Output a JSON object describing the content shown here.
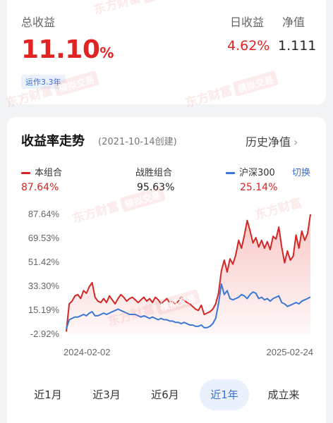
{
  "summary": {
    "total_label": "总收益",
    "total_value": "11.10",
    "total_unit": "%",
    "run_badge": "运作3.3年",
    "day_label": "日收益",
    "day_value": "4.62%",
    "nav_label": "净值",
    "nav_value": "1.111"
  },
  "watermark": {
    "brand": "东方财富",
    "tag": "模拟交易"
  },
  "section": {
    "title": "收益率走势",
    "subtitle": "(2021-10-14创建)",
    "history_label": "历史净值",
    "history_chevron": "›"
  },
  "legend": [
    {
      "name": "本组合",
      "value": "87.64%",
      "color": "#d32626"
    },
    {
      "name": "战胜组合",
      "value": "95.63%",
      "color": "#222222"
    },
    {
      "name": "沪深300",
      "value": "25.14%",
      "color": "#3a78d6"
    }
  ],
  "switch_label": "切换",
  "tabs": [
    {
      "label": "近1月",
      "active": false
    },
    {
      "label": "近3月",
      "active": false
    },
    {
      "label": "近6月",
      "active": false
    },
    {
      "label": "近1年",
      "active": true
    },
    {
      "label": "成立来",
      "active": false
    }
  ],
  "chart_data": {
    "type": "area",
    "x_start": "2024-02-02",
    "x_end": "2025-02-24",
    "x_tick_labels": [
      "2024-02-02",
      "2025-02-24"
    ],
    "y_tick_labels": [
      "87.64%",
      "69.53%",
      "51.42%",
      "33.30%",
      "15.19%",
      "-2.92%"
    ],
    "ylim": [
      -2.92,
      87.64
    ],
    "grid": false,
    "series": [
      {
        "name": "本组合",
        "color": "#d32626",
        "fill": true,
        "values": [
          -1,
          20,
          22,
          26,
          27,
          24,
          30,
          28,
          33,
          36,
          25,
          22,
          21,
          24,
          21,
          26,
          23,
          20,
          24,
          27,
          25,
          22,
          24,
          25,
          23,
          21,
          23,
          25,
          22,
          24,
          21,
          25,
          23,
          20,
          22,
          24,
          21,
          22,
          20,
          22,
          25,
          23,
          21,
          20,
          18,
          16,
          15,
          19,
          12,
          13,
          14,
          16,
          20,
          28,
          45,
          53,
          44,
          54,
          50,
          57,
          68,
          62,
          72,
          83,
          75,
          66,
          70,
          63,
          68,
          62,
          67,
          61,
          71,
          69,
          78,
          63,
          51,
          60,
          53,
          56,
          72,
          62,
          75,
          68,
          73,
          87.64
        ]
      },
      {
        "name": "沪深300",
        "color": "#3a78d6",
        "fill": false,
        "values": [
          1,
          8,
          9,
          10,
          10,
          11,
          12,
          11,
          13,
          14,
          11,
          11,
          12,
          13,
          12,
          13,
          14,
          15,
          16,
          15,
          14,
          13,
          12,
          12,
          12,
          11,
          10,
          11,
          10,
          9,
          10,
          9,
          8,
          9,
          8,
          8,
          7,
          7,
          6,
          6,
          5,
          6,
          5,
          4,
          4,
          3,
          3,
          4,
          2,
          2,
          3,
          5,
          9,
          20,
          35,
          27,
          30,
          24,
          23,
          24,
          25,
          27,
          26,
          24,
          27,
          29,
          28,
          24,
          25,
          23,
          24,
          22,
          24,
          25,
          26,
          21,
          20,
          18,
          19,
          20,
          21,
          20,
          22,
          23,
          24,
          25.14
        ]
      }
    ]
  }
}
